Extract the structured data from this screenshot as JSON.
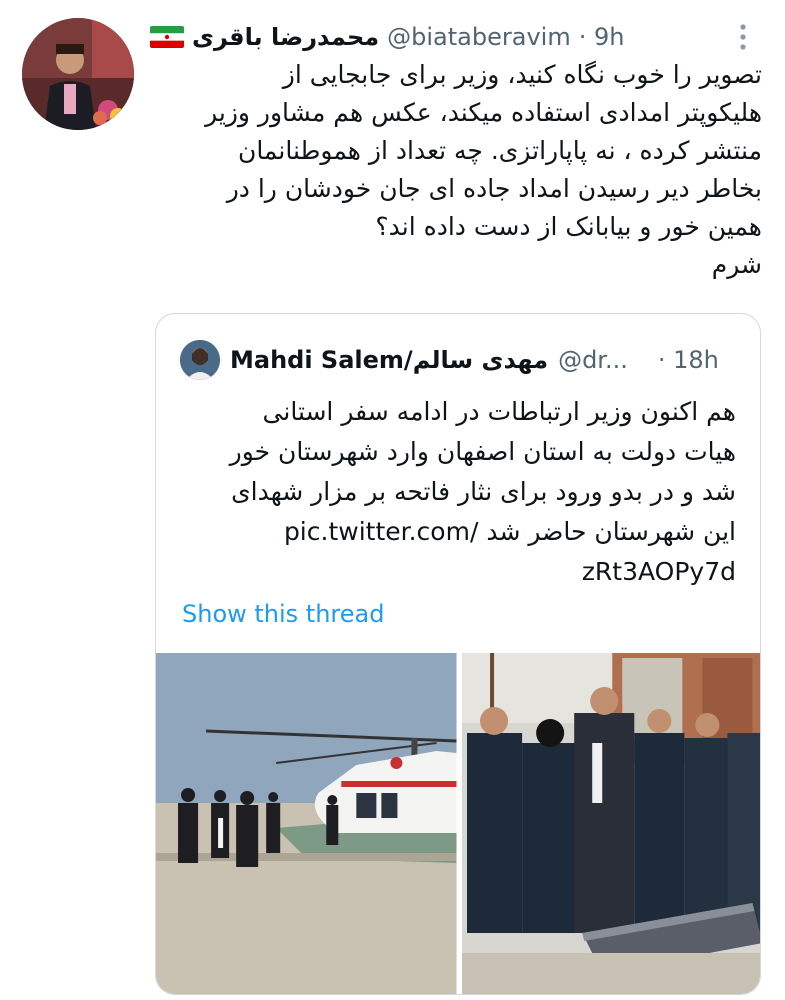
{
  "tweet": {
    "author_name": "محمدرضا باقری",
    "handle": "@biataberavim",
    "time": "· 9h",
    "text": "تصویر را خوب نگاه کنید، وزیر برای جابجایی از\nهلیکوپتر امدادی استفاده میکند، عکس هم مشاور وزیر\nمنتشر کرده ، نه پاپاراتزی. چه تعداد از هموطنانمان\nبخاطر دیر رسیدن امداد جاده ای جان خودشان را در\nهمین خور و بیابانک از دست داده اند؟\nشرم"
  },
  "quoted": {
    "author_name": "Mahdi Salem/مهدی سالم",
    "handle": "@dr...",
    "time": "· 18h",
    "text": "هم اکنون وزیر ارتباطات در ادامه سفر استانی\nهیات دولت به استان اصفهان وارد شهرستان خور\nشد و در بدو ورود برای نثار فاتحه بر مزار شهدای\nاین شهرستان حاضر شد /pic.twitter.com\nzRt3AOPy7d",
    "show_thread": "Show this thread"
  },
  "icons": {
    "flag": "iran-flag-icon",
    "more": "more-vertical-icon"
  },
  "colors": {
    "link": "#1d9bf0",
    "secondary_text": "#536471",
    "border": "#cfd9de"
  }
}
